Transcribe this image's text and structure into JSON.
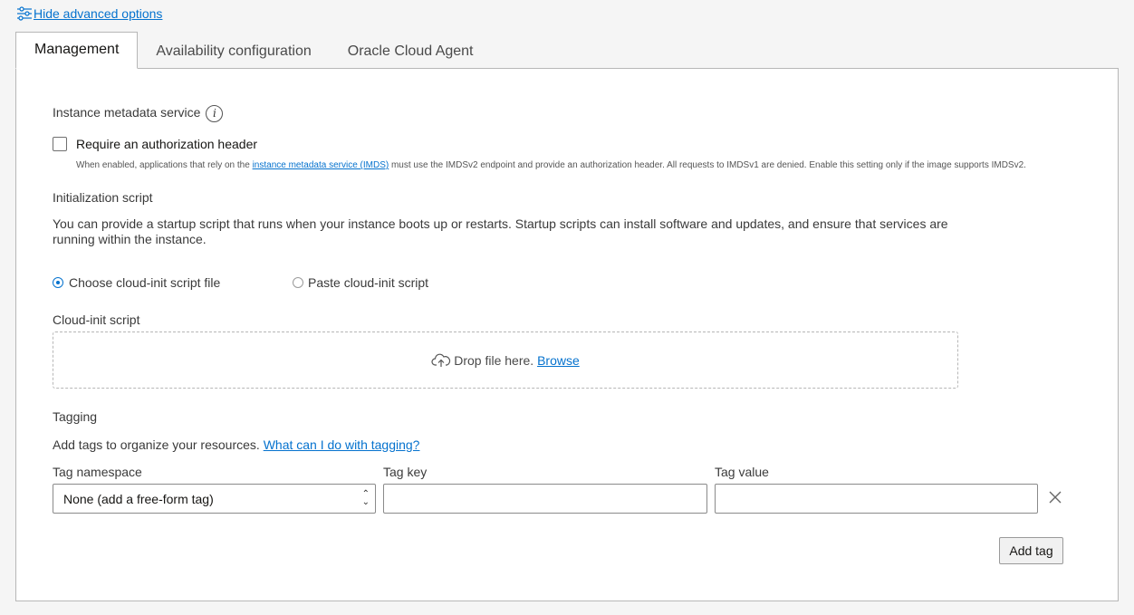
{
  "advanced": {
    "toggle_label": "Hide advanced options"
  },
  "tabs": [
    {
      "label": "Management",
      "active": true
    },
    {
      "label": "Availability configuration",
      "active": false
    },
    {
      "label": "Oracle Cloud Agent",
      "active": false
    }
  ],
  "imds": {
    "heading": "Instance metadata service",
    "info_icon": "i",
    "checkbox_label": "Require an authorization header",
    "checked": false,
    "help_pre": "When enabled, applications that rely on the ",
    "help_link": "instance metadata service (IMDS)",
    "help_post": " must use the IMDSv2 endpoint and provide an authorization header. All requests to IMDSv1 are denied. Enable this setting only if the image supports IMDSv2."
  },
  "init_script": {
    "heading": "Initialization script",
    "description": "You can provide a startup script that runs when your instance boots up or restarts. Startup scripts can install software and updates, and ensure that services are running within the instance.",
    "option_file": "Choose cloud-init script file",
    "option_paste": "Paste cloud-init script",
    "selected": "file",
    "field_label": "Cloud-init script",
    "drop_text": "Drop file here. ",
    "browse_link": "Browse"
  },
  "tagging": {
    "heading": "Tagging",
    "description": "Add tags to organize your resources. ",
    "help_link": "What can I do with tagging?",
    "namespace_label": "Tag namespace",
    "namespace_value": "None (add a free-form tag)",
    "key_label": "Tag key",
    "key_value": "",
    "value_label": "Tag value",
    "value_value": "",
    "add_button": "Add tag"
  },
  "colors": {
    "link": "#0572ce",
    "accent": "#0572ce",
    "panel_border": "#b7b7b7"
  }
}
